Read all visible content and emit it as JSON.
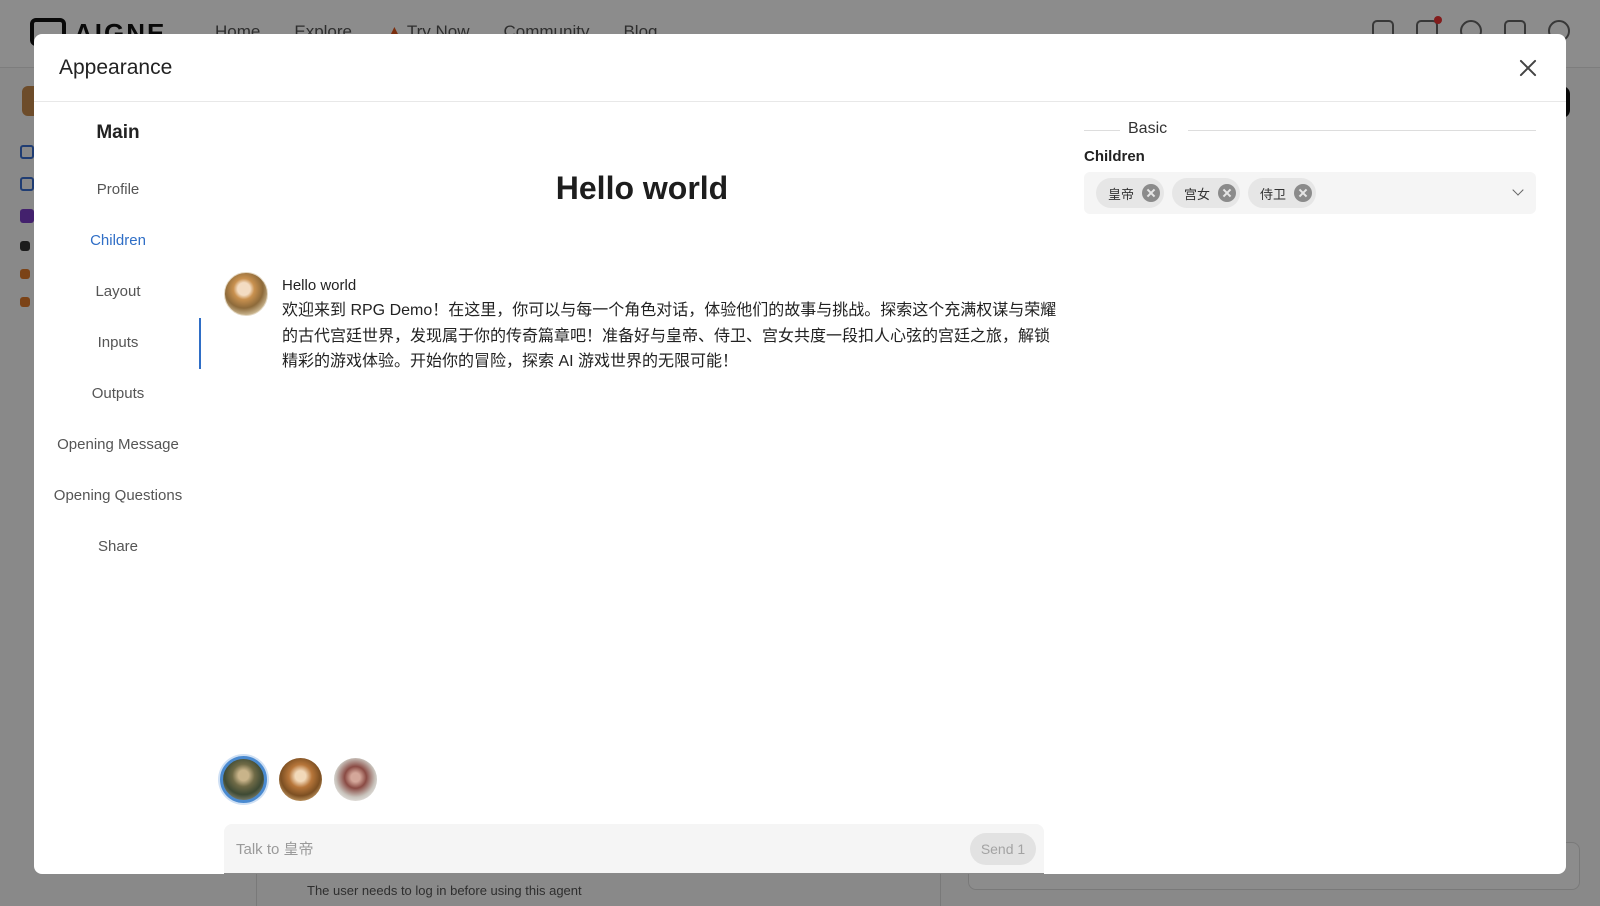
{
  "background": {
    "logo_text": "AIGNE",
    "nav": [
      "Home",
      "Explore",
      "Try Now",
      "Community",
      "Blog"
    ],
    "footnote": "The user needs to log in before using this agent"
  },
  "modal": {
    "title": "Appearance",
    "close_label": "Close"
  },
  "side_nav": {
    "heading": "Main",
    "items": [
      {
        "label": "Profile"
      },
      {
        "label": "Children"
      },
      {
        "label": "Layout"
      },
      {
        "label": "Inputs"
      },
      {
        "label": "Outputs"
      },
      {
        "label": "Opening Message"
      },
      {
        "label": "Opening Questions"
      },
      {
        "label": "Share"
      }
    ],
    "active": "Children"
  },
  "preview": {
    "title": "Hello world",
    "message": {
      "author": "Hello world",
      "text": "欢迎来到 RPG Demo！在这里，你可以与每一个角色对话，体验他们的故事与挑战。探索这个充满权谋与荣耀的古代宫廷世界，发现属于你的传奇篇章吧！准备好与皇帝、侍卫、宫女共度一段扣人心弦的宫廷之旅，解锁精彩的游戏体验。开始你的冒险，探索 AI 游戏世界的无限可能！"
    },
    "characters": [
      "皇帝",
      "宫女",
      "侍卫"
    ],
    "selected_character": "皇帝",
    "input": {
      "placeholder": "Talk to 皇帝",
      "value": ""
    },
    "send_label": "Send 1"
  },
  "settings": {
    "section_title": "Basic",
    "children_label": "Children",
    "children_selected": [
      "皇帝",
      "宫女",
      "侍卫"
    ]
  },
  "colors": {
    "accent": "#2f6ec6",
    "overlay": "rgba(0,0,0,0.45)"
  }
}
